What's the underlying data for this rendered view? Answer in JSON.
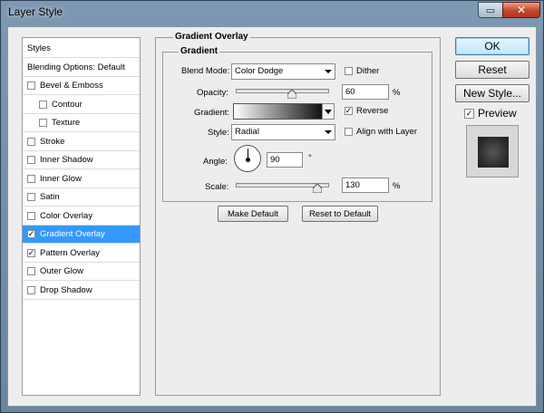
{
  "window": {
    "title": "Layer Style",
    "restore_glyph": "▭",
    "close_glyph": "✕"
  },
  "style_list": {
    "items": [
      {
        "label": "Styles",
        "checkbox": false,
        "checked": false,
        "indent": 0,
        "selected": false
      },
      {
        "label": "Blending Options: Default",
        "checkbox": false,
        "checked": false,
        "indent": 0,
        "selected": false
      },
      {
        "label": "Bevel & Emboss",
        "checkbox": true,
        "checked": false,
        "indent": 0,
        "selected": false
      },
      {
        "label": "Contour",
        "checkbox": true,
        "checked": false,
        "indent": 1,
        "selected": false
      },
      {
        "label": "Texture",
        "checkbox": true,
        "checked": false,
        "indent": 1,
        "selected": false
      },
      {
        "label": "Stroke",
        "checkbox": true,
        "checked": false,
        "indent": 0,
        "selected": false
      },
      {
        "label": "Inner Shadow",
        "checkbox": true,
        "checked": false,
        "indent": 0,
        "selected": false
      },
      {
        "label": "Inner Glow",
        "checkbox": true,
        "checked": false,
        "indent": 0,
        "selected": false
      },
      {
        "label": "Satin",
        "checkbox": true,
        "checked": false,
        "indent": 0,
        "selected": false
      },
      {
        "label": "Color Overlay",
        "checkbox": true,
        "checked": false,
        "indent": 0,
        "selected": false
      },
      {
        "label": "Gradient Overlay",
        "checkbox": true,
        "checked": true,
        "indent": 0,
        "selected": true
      },
      {
        "label": "Pattern Overlay",
        "checkbox": true,
        "checked": true,
        "indent": 0,
        "selected": false
      },
      {
        "label": "Outer Glow",
        "checkbox": true,
        "checked": false,
        "indent": 0,
        "selected": false
      },
      {
        "label": "Drop Shadow",
        "checkbox": true,
        "checked": false,
        "indent": 0,
        "selected": false
      }
    ]
  },
  "gradient_overlay": {
    "section_title": "Gradient Overlay",
    "group_title": "Gradient",
    "blend_mode": {
      "label": "Blend Mode:",
      "value": "Color Dodge"
    },
    "dither": {
      "label": "Dither",
      "checked": false
    },
    "opacity": {
      "label": "Opacity:",
      "value": "60",
      "unit": "%",
      "slider_fraction": 0.6
    },
    "gradient": {
      "label": "Gradient:"
    },
    "reverse": {
      "label": "Reverse",
      "checked": true
    },
    "style": {
      "label": "Style:",
      "value": "Radial"
    },
    "align_with_layer": {
      "label": "Align with Layer",
      "checked": false
    },
    "angle": {
      "label": "Angle:",
      "value": "90",
      "unit": "°"
    },
    "scale": {
      "label": "Scale:",
      "value": "130",
      "unit": "%",
      "slider_fraction": 0.87
    },
    "make_default_label": "Make Default",
    "reset_to_default_label": "Reset to Default"
  },
  "right_panel": {
    "ok_label": "OK",
    "reset_label": "Reset",
    "new_style_label": "New Style...",
    "preview": {
      "label": "Preview",
      "checked": true
    }
  },
  "check_glyph": "✓"
}
